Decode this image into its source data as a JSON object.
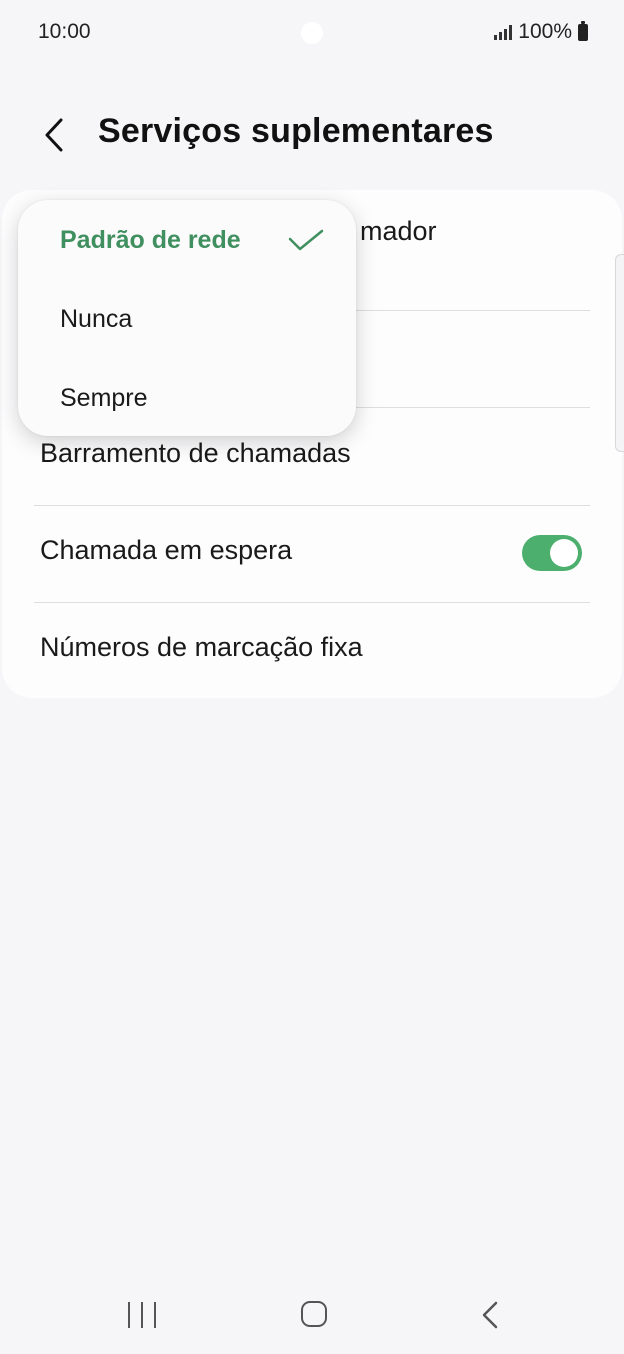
{
  "status": {
    "time": "10:00",
    "battery": "100%"
  },
  "header": {
    "title": "Serviços suplementares",
    "back_icon": "chevron-left-icon"
  },
  "list": {
    "item1_partial": "mador",
    "item3": "Barramento de chamadas",
    "item4": "Chamada em espera",
    "item5": "Números de marcação fixa",
    "call_waiting_enabled": true
  },
  "dropdown": {
    "options": [
      "Padrão de rede",
      "Nunca",
      "Sempre"
    ],
    "selected_index": 0
  },
  "colors": {
    "accent": "#3f8f5f",
    "toggle_on": "#4caf6e"
  },
  "nav": {
    "recent_icon": "recent-apps-icon",
    "home_icon": "home-icon",
    "back_icon": "back-icon"
  }
}
